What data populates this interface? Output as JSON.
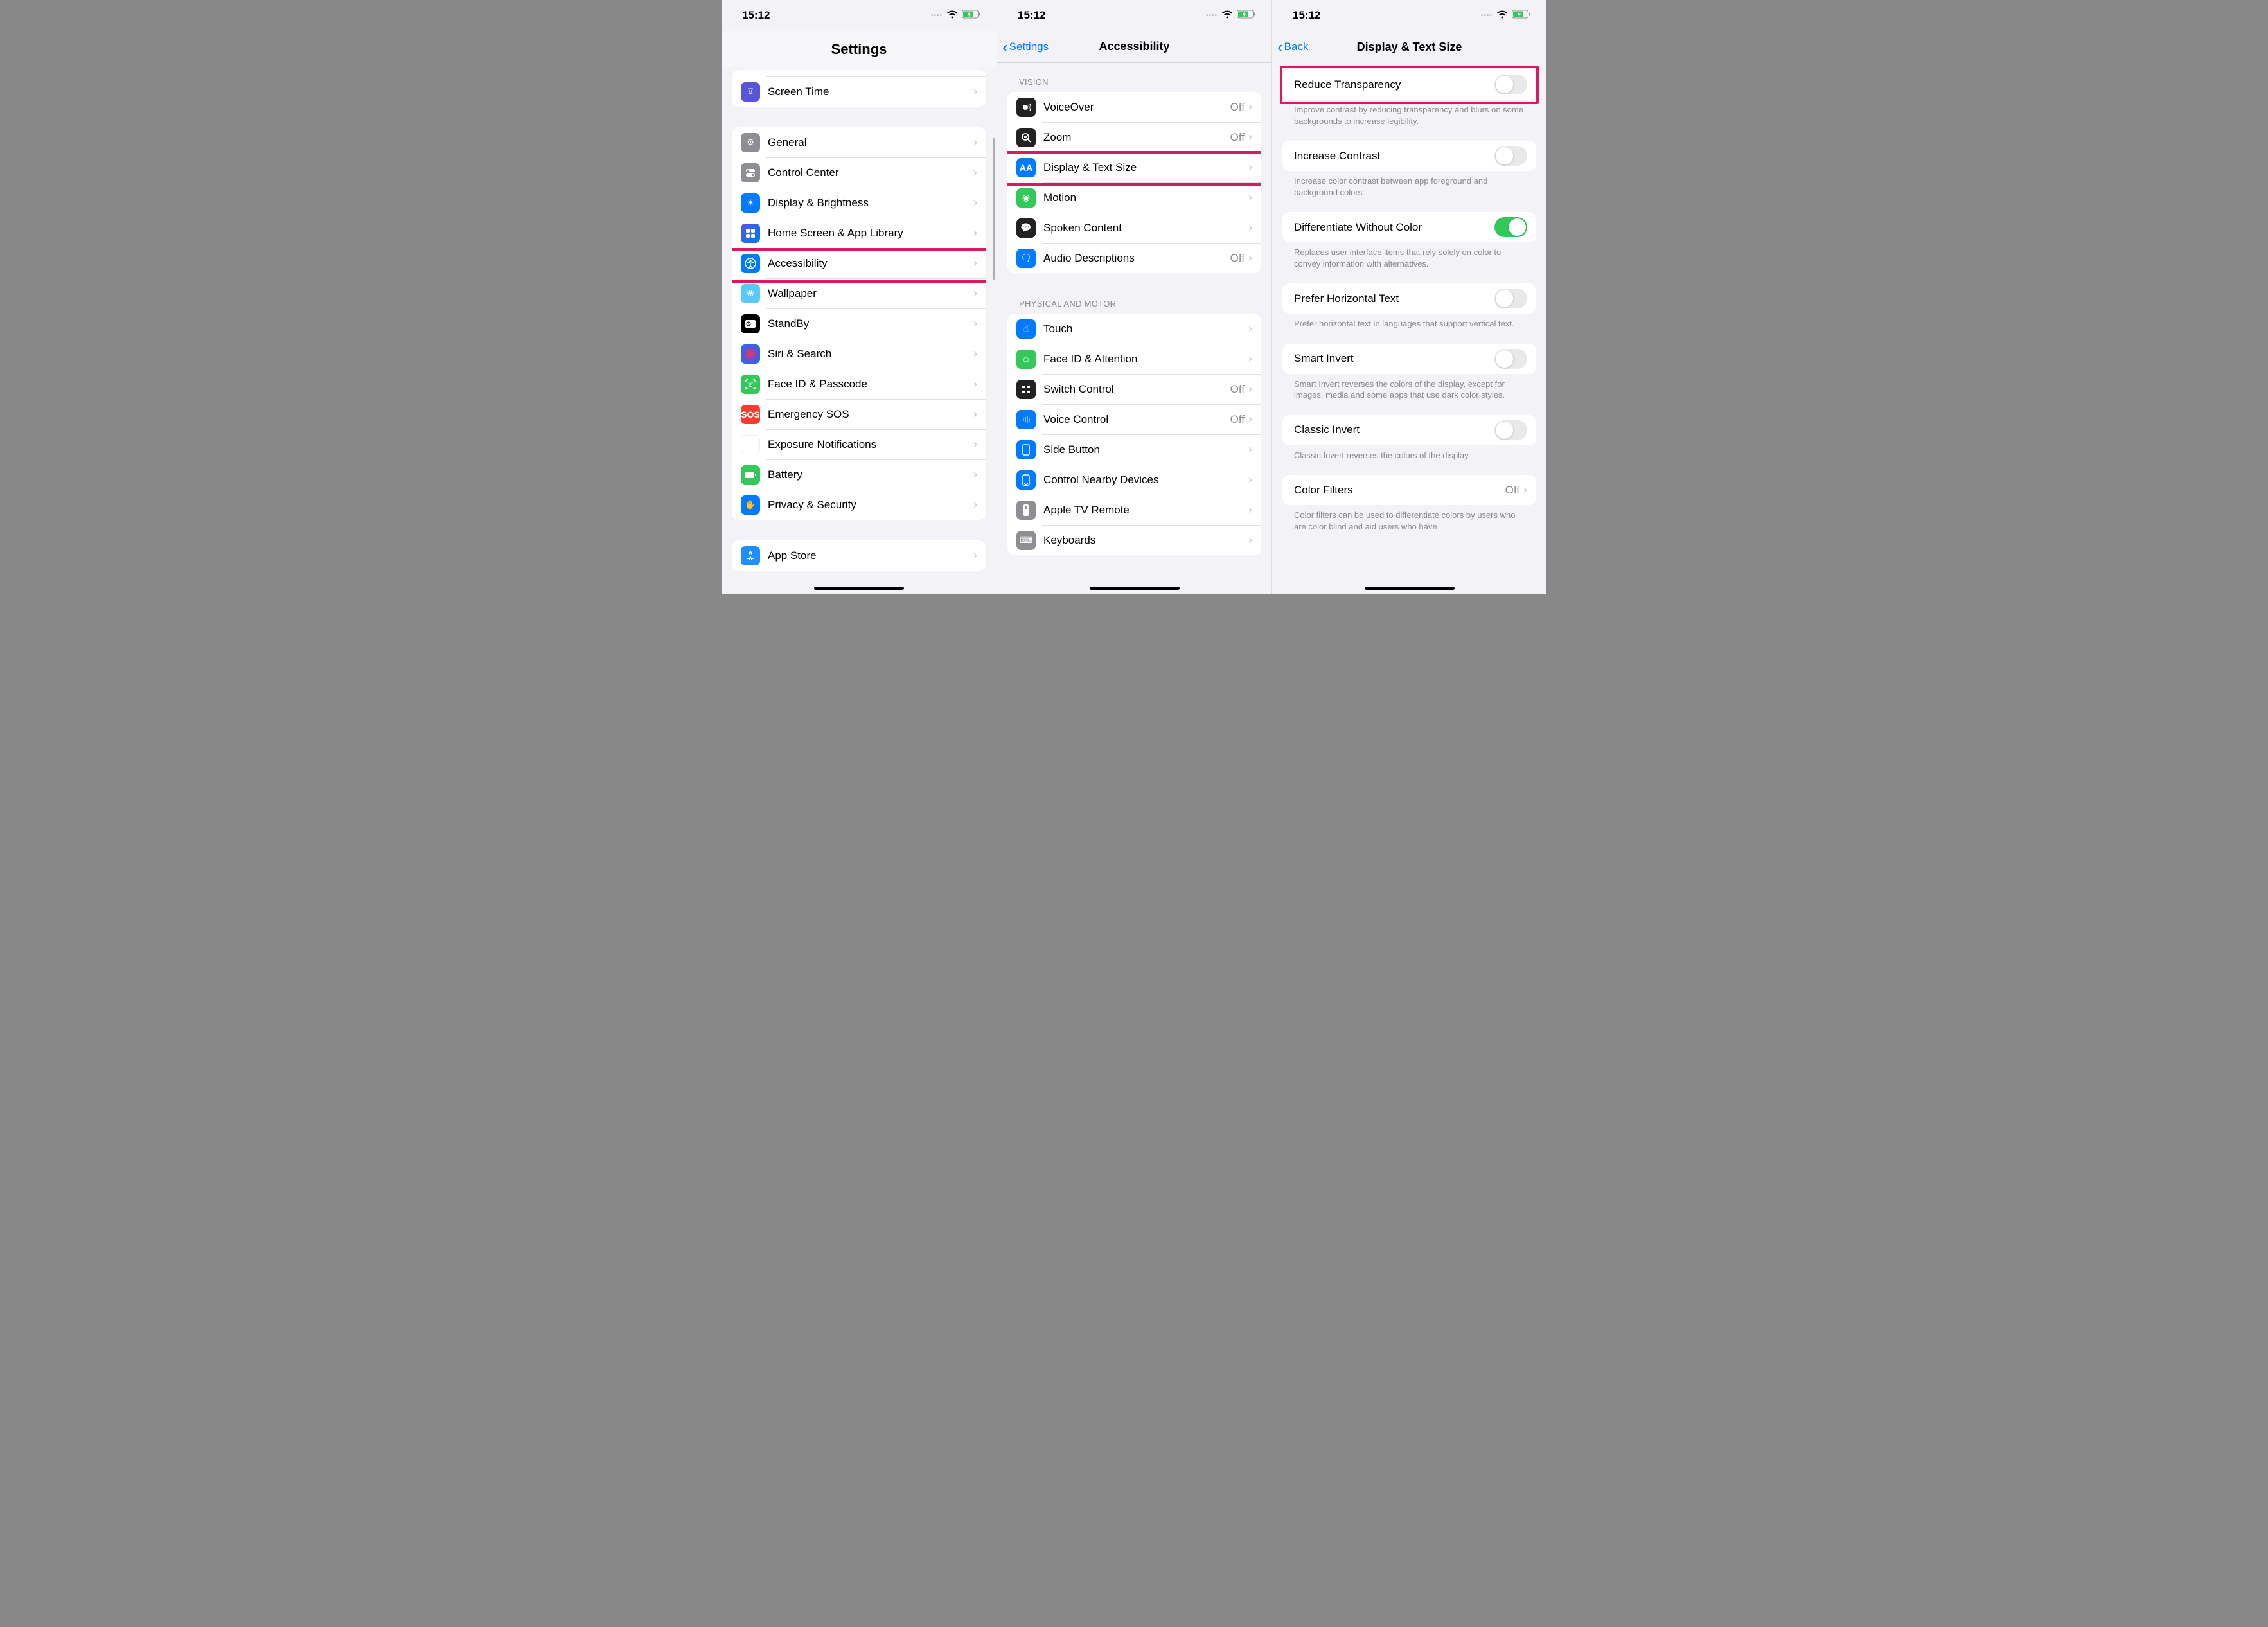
{
  "status": {
    "time": "15:12"
  },
  "screen1": {
    "title": "Settings",
    "partial_row": {
      "label": "Screen Time",
      "icon": "hourglass"
    },
    "group": [
      {
        "label": "General",
        "icon": "general"
      },
      {
        "label": "Control Center",
        "icon": "cc"
      },
      {
        "label": "Display & Brightness",
        "icon": "display"
      },
      {
        "label": "Home Screen & App Library",
        "icon": "home"
      },
      {
        "label": "Accessibility",
        "icon": "accessibility",
        "highlighted": true
      },
      {
        "label": "Wallpaper",
        "icon": "wallpaper"
      },
      {
        "label": "StandBy",
        "icon": "standby"
      },
      {
        "label": "Siri & Search",
        "icon": "siri"
      },
      {
        "label": "Face ID & Passcode",
        "icon": "faceid"
      },
      {
        "label": "Emergency SOS",
        "icon": "sos"
      },
      {
        "label": "Exposure Notifications",
        "icon": "exposure"
      },
      {
        "label": "Battery",
        "icon": "battery"
      },
      {
        "label": "Privacy & Security",
        "icon": "privacy"
      }
    ],
    "group2": [
      {
        "label": "App Store",
        "icon": "appstore"
      }
    ]
  },
  "screen2": {
    "back": "Settings",
    "title": "Accessibility",
    "vision_header": "VISION",
    "vision": [
      {
        "label": "VoiceOver",
        "icon": "voiceover",
        "value": "Off"
      },
      {
        "label": "Zoom",
        "icon": "zoom",
        "value": "Off"
      },
      {
        "label": "Display & Text Size",
        "icon": "textsize",
        "highlighted": true
      },
      {
        "label": "Motion",
        "icon": "motion"
      },
      {
        "label": "Spoken Content",
        "icon": "spoken"
      },
      {
        "label": "Audio Descriptions",
        "icon": "audiodesc",
        "value": "Off"
      }
    ],
    "motor_header": "PHYSICAL AND MOTOR",
    "motor": [
      {
        "label": "Touch",
        "icon": "touch"
      },
      {
        "label": "Face ID & Attention",
        "icon": "faceatt"
      },
      {
        "label": "Switch Control",
        "icon": "switch",
        "value": "Off"
      },
      {
        "label": "Voice Control",
        "icon": "voicectrl",
        "value": "Off"
      },
      {
        "label": "Side Button",
        "icon": "sidebtn"
      },
      {
        "label": "Control Nearby Devices",
        "icon": "nearby"
      },
      {
        "label": "Apple TV Remote",
        "icon": "atvremote"
      },
      {
        "label": "Keyboards",
        "icon": "keyboards"
      }
    ]
  },
  "screen3": {
    "back": "Back",
    "title": "Display & Text Size",
    "items": [
      {
        "label": "Reduce Transparency",
        "on": false,
        "highlighted": true,
        "footer": "Improve contrast by reducing transparency and blurs on some backgrounds to increase legibility."
      },
      {
        "label": "Increase Contrast",
        "on": false,
        "footer": "Increase color contrast between app foreground and background colors."
      },
      {
        "label": "Differentiate Without Color",
        "on": true,
        "footer": "Replaces user interface items that rely solely on color to convey information with alternatives."
      },
      {
        "label": "Prefer Horizontal Text",
        "on": false,
        "footer": "Prefer horizontal text in languages that support vertical text."
      },
      {
        "label": "Smart Invert",
        "on": false,
        "footer": "Smart Invert reverses the colors of the display, except for images, media and some apps that use dark color styles."
      },
      {
        "label": "Classic Invert",
        "on": false,
        "footer": "Classic Invert reverses the colors of the display."
      },
      {
        "label": "Color Filters",
        "value": "Off",
        "chevron": true,
        "footer": "Color filters can be used to differentiate colors by users who are color blind and aid users who have"
      }
    ]
  }
}
